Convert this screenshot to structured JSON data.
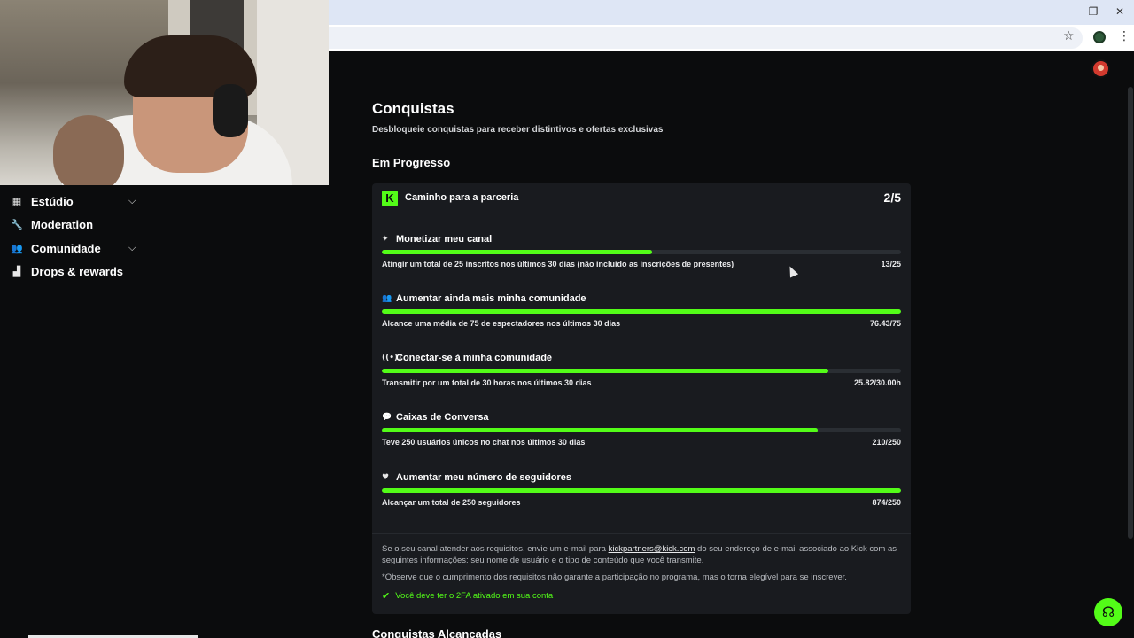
{
  "browser": {
    "window_controls": [
      "–",
      "❐",
      "✕"
    ]
  },
  "sidebar": {
    "items": [
      {
        "label": "Estúdio",
        "icon": "studio-icon"
      },
      {
        "label": "Moderation",
        "icon": "wrench-icon"
      },
      {
        "label": "Comunidade",
        "icon": "community-icon"
      },
      {
        "label": "Drops & rewards",
        "icon": "drops-icon"
      }
    ]
  },
  "main": {
    "title": "Conquistas",
    "subtitle": "Desbloqueie conquistas para receber distintivos e ofertas exclusivas",
    "section_in_progress": "Em Progresso",
    "section_achieved": "Conquistas Alcançadas"
  },
  "card": {
    "title": "Caminho para a parceria",
    "count": "2/5",
    "achievements": [
      {
        "title": "Monetizar meu canal",
        "icon": "sparkle-icon",
        "desc": "Atingir um total de 25 inscritos nos últimos 30 dias (não incluído as inscrições de presentes)",
        "value": "13/25",
        "progress": 0.52
      },
      {
        "title": "Aumentar ainda mais minha comunidade",
        "icon": "users-icon",
        "desc": "Alcance uma média de 75 de espectadores nos últimos 30 dias",
        "value": "76.43/75",
        "progress": 1.0
      },
      {
        "title": "Conectar-se à minha comunidade",
        "icon": "broadcast-icon",
        "desc": "Transmitir por um total de 30 horas nos últimos 30 dias",
        "value": "25.82/30.00h",
        "progress": 0.86
      },
      {
        "title": "Caixas de Conversa",
        "icon": "chat-icon",
        "desc": "Teve 250 usuários únicos no chat nos últimos 30 dias",
        "value": "210/250",
        "progress": 0.84
      },
      {
        "title": "Aumentar meu número de seguidores",
        "icon": "heart-icon",
        "desc": "Alcançar um total de 250 seguidores",
        "value": "874/250",
        "progress": 1.0
      }
    ],
    "footer": {
      "text_before": "Se o seu canal atender aos requisitos, envie um e-mail para ",
      "email": "kickpartners@kick.com",
      "text_after": " do seu endereço de e-mail associado ao Kick com as seguintes informações: seu nome de usuário e o tipo de conteúdo que você transmite.",
      "note": "*Observe que o cumprimento dos requisitos não garante a participação no programa, mas o torna elegível para se inscrever.",
      "twofa": "Você deve ter o 2FA ativado em sua conta"
    }
  },
  "colors": {
    "accent": "#53fc18",
    "background": "#0b0c0d",
    "card": "#191b1f"
  }
}
